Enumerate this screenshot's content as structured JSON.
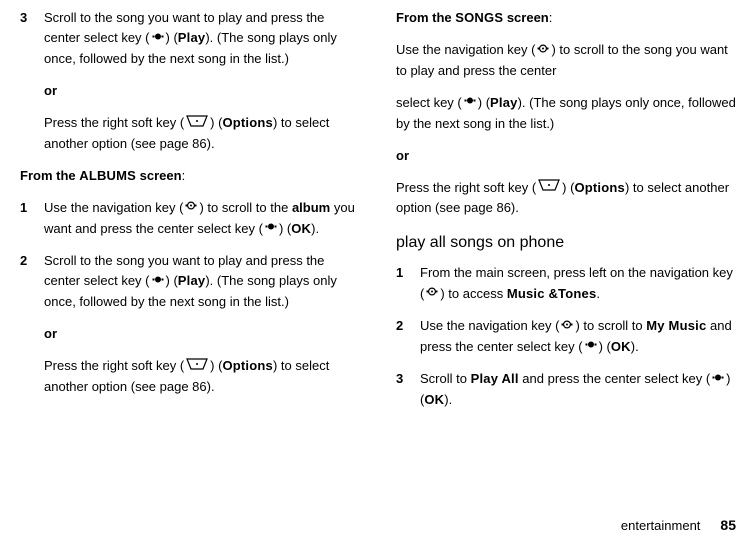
{
  "left": {
    "step3_pre": "Scroll to the song you want to play and press the center select key (",
    "step3_play": "Play",
    "step3_post": "). (The song plays only once, followed by the next song in the list.)",
    "or": "or",
    "press_softkey_pre": "Press the right soft key (",
    "options": "Options",
    "press_softkey_post": ") to select another option (see page 86).",
    "from_albums_pre": "From the ",
    "from_albums_label": "ALBUMS",
    "from_albums_post": " screen",
    "step1_pre": "Use the navigation key (",
    "step1_mid1": ") to scroll to the ",
    "step1_album": "album",
    "step1_mid2": " you want and press the center select key (",
    "ok": "OK",
    "step1_post": ").",
    "step2_pre": "Scroll to the song you want to play and press the center select key (",
    "step2_play": "Play",
    "step2_post": "). (The song plays only once, followed by the next song in the list.)"
  },
  "right": {
    "from_songs_pre": "From the ",
    "from_songs_label": "SONGS",
    "from_songs_post": " screen",
    "p1_pre": "Use the navigation key (",
    "p1_post": ") to scroll to the song you want to play and press the center",
    "p2_pre": "select key (",
    "p2_play": "Play",
    "p2_post": "). (The song plays only once, followed by the next song in the list.)",
    "or": "or",
    "soft_pre": "Press the right soft key (",
    "options": "Options",
    "soft_post": ") to select another option (see page 86).",
    "heading": "play all songs on phone",
    "s1_pre": "From the main screen, press left on the navigation key (",
    "s1_mid": ") to access ",
    "s1_label": "Music &Tones",
    "s1_post": ".",
    "s2_pre": "Use the navigation key (",
    "s2_mid1": ") to scroll to ",
    "s2_mymusic": "My Music",
    "s2_mid2": " and press the center select key (",
    "ok": "OK",
    "s2_post": ").",
    "s3_pre": "Scroll to ",
    "s3_playall": "Play All",
    "s3_mid": " and press the center select key (",
    "s3_post": ")."
  },
  "footer": {
    "label": "entertainment",
    "page": "85"
  },
  "nums": {
    "n1": "1",
    "n2": "2",
    "n3": "3"
  }
}
